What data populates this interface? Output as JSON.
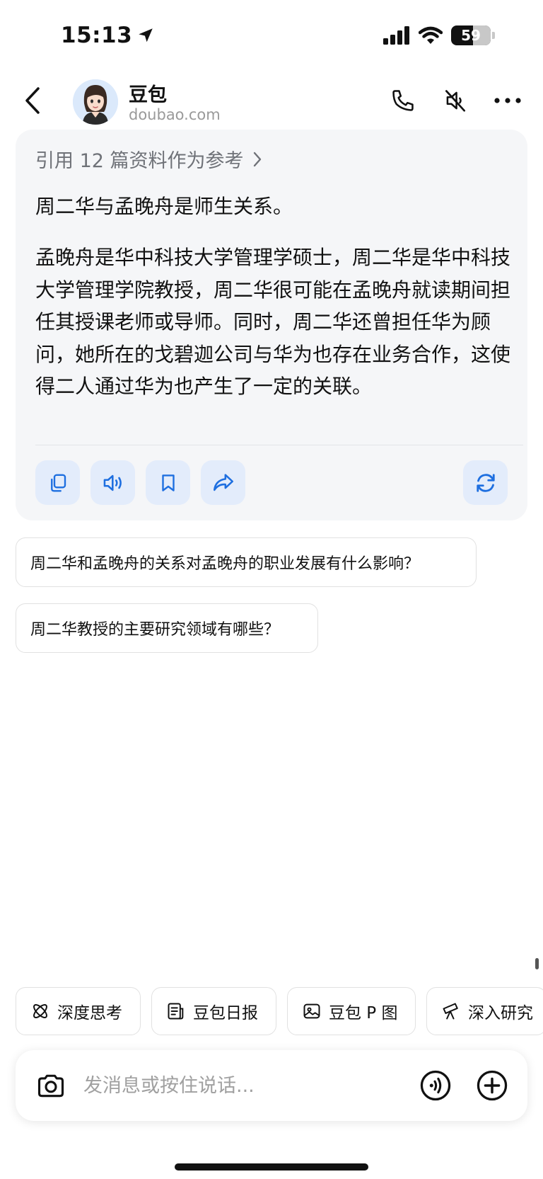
{
  "status_bar": {
    "time": "15:13",
    "battery_level": "59",
    "icons": [
      "location-arrow-icon",
      "cellular-signal-icon",
      "wifi-icon",
      "battery-icon"
    ]
  },
  "header": {
    "title": "豆包",
    "subtitle": "doubao.com",
    "icons": [
      "back-chevron-icon",
      "avatar",
      "phone-icon",
      "speaker-muted-icon",
      "more-dots-icon"
    ]
  },
  "answer_card": {
    "reference_link": "引用 12 篇资料作为参考",
    "paragraph_1": "周二华与孟晚舟是师生关系。",
    "paragraph_2": "孟晚舟是华中科技大学管理学硕士，周二华是华中科技大学管理学院教授，周二华很可能在孟晚舟就读期间担任其授课老师或导师。同时，周二华还曾担任华为顾问，她所在的戈碧迦公司与华为也存在业务合作，这使得二人通过华为也产生了一定的关联。",
    "actions": [
      "copy-icon",
      "speaker-icon",
      "bookmark-icon",
      "share-icon",
      "refresh-icon"
    ]
  },
  "suggestions": [
    "周二华和孟晚舟的关系对孟晚舟的职业发展有什么影响？",
    "周二华教授的主要研究领域有哪些？"
  ],
  "shortcuts": [
    {
      "label": "深度思考",
      "icon": "atom-icon"
    },
    {
      "label": "豆包日报",
      "icon": "newspaper-icon"
    },
    {
      "label": "豆包 P 图",
      "icon": "image-edit-icon"
    },
    {
      "label": "深入研究",
      "icon": "telescope-icon"
    }
  ],
  "input": {
    "placeholder": "发消息或按住说话...",
    "value": ""
  },
  "colors": {
    "accent": "#1e6fe0",
    "action_bg": "#e3ecfb",
    "card_bg": "#f5f6f8",
    "muted_text": "#9a9a9a"
  }
}
